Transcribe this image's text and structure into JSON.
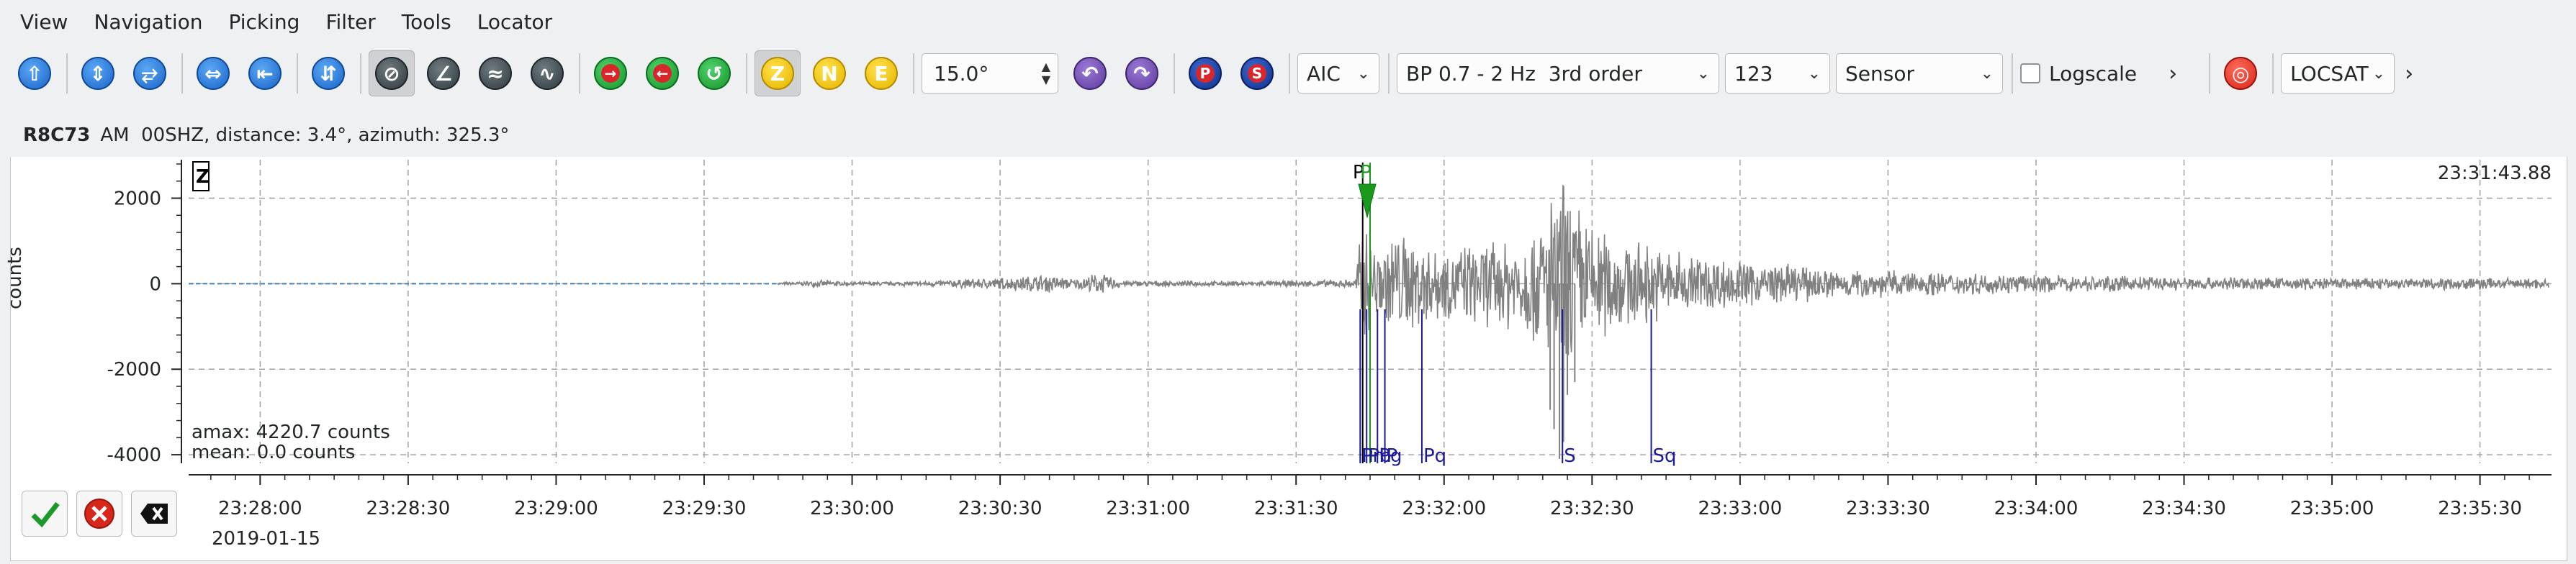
{
  "menubar": {
    "items": [
      "View",
      "Navigation",
      "Picking",
      "Filter",
      "Tools",
      "Locator"
    ]
  },
  "toolbar": {
    "z_label": "Z",
    "n_label": "N",
    "e_label": "E",
    "angle_value": "15.0°",
    "p_label": "P",
    "s_label": "S",
    "picker_value": "AIC",
    "filter_value": "BP 0.7 - 2 Hz  3rd order",
    "components_value": "123",
    "rotation_value": "Sensor",
    "logscale_label": "Logscale",
    "locator_value": "LOCSAT",
    "overflow_glyph": "›"
  },
  "trace": {
    "station": "R8C73",
    "info": "AM  00SHZ, distance: 3.4°, azimuth: 325.3°",
    "component_tag": "Z",
    "end_time": "23:31:43.88",
    "amax": "amax: 4220.7 counts",
    "mean": "mean: 0.0 counts",
    "ylabel": "counts",
    "date": "2019-01-15"
  },
  "chart_data": {
    "type": "line",
    "xlabel": "",
    "ylabel": "counts",
    "ylim": [
      -4200,
      2900
    ],
    "y_ticks": [
      "2000",
      "0",
      "-2000",
      "-4000"
    ],
    "y_tick_values": [
      2000,
      0,
      -2000,
      -4000
    ],
    "x_ticks": [
      "23:28:00",
      "23:28:30",
      "23:29:00",
      "23:29:30",
      "23:30:00",
      "23:30:30",
      "23:31:00",
      "23:31:30",
      "23:32:00",
      "23:32:30",
      "23:33:00",
      "23:33:30",
      "23:34:00",
      "23:34:30",
      "23:35:00",
      "23:35:30"
    ],
    "x_tick_seconds": [
      0,
      30,
      60,
      90,
      120,
      150,
      180,
      210,
      240,
      270,
      300,
      330,
      360,
      390,
      420,
      450
    ],
    "xlim_seconds": [
      -14.5,
      464.5
    ],
    "data_start_seconds": 105,
    "grid": true,
    "picks_top": [
      {
        "label": "P",
        "t": 223.5,
        "color": "#000000"
      },
      {
        "label": "P",
        "t": 225.0,
        "color": "#1a9a1a"
      }
    ],
    "picks_bottom": [
      {
        "label": "Pn",
        "t": 223.0
      },
      {
        "label": "Pb",
        "t": 224.3
      },
      {
        "label": "Pg",
        "t": 226.5
      },
      {
        "label": "P",
        "t": 228.0
      },
      {
        "label": "Pq",
        "t": 235.5
      },
      {
        "label": "S",
        "t": 264.0
      },
      {
        "label": "Sq",
        "t": 282.0
      }
    ],
    "envelope": [
      {
        "t": 105,
        "a": 30
      },
      {
        "t": 110,
        "a": 60
      },
      {
        "t": 115,
        "a": 90
      },
      {
        "t": 120,
        "a": 45
      },
      {
        "t": 135,
        "a": 70
      },
      {
        "t": 150,
        "a": 160
      },
      {
        "t": 160,
        "a": 240
      },
      {
        "t": 165,
        "a": 120
      },
      {
        "t": 170,
        "a": 280
      },
      {
        "t": 175,
        "a": 80
      },
      {
        "t": 200,
        "a": 60
      },
      {
        "t": 215,
        "a": 90
      },
      {
        "t": 222,
        "a": 120
      },
      {
        "t": 223.5,
        "a": 1900
      },
      {
        "t": 226,
        "a": 900
      },
      {
        "t": 230,
        "a": 1400
      },
      {
        "t": 240,
        "a": 900
      },
      {
        "t": 250,
        "a": 1100
      },
      {
        "t": 258,
        "a": 1400
      },
      {
        "t": 262,
        "a": 2300
      },
      {
        "t": 265,
        "a": 2800
      },
      {
        "t": 268,
        "a": 1800
      },
      {
        "t": 275,
        "a": 1200
      },
      {
        "t": 285,
        "a": 900
      },
      {
        "t": 300,
        "a": 600
      },
      {
        "t": 320,
        "a": 380
      },
      {
        "t": 340,
        "a": 300
      },
      {
        "t": 360,
        "a": 220
      },
      {
        "t": 390,
        "a": 180
      },
      {
        "t": 420,
        "a": 150
      },
      {
        "t": 450,
        "a": 160
      },
      {
        "t": 464,
        "a": 120
      }
    ],
    "deep_spikes": [
      {
        "t": 261.5,
        "v": -2950
      },
      {
        "t": 262.3,
        "v": -3400
      },
      {
        "t": 263.4,
        "v": -4100
      },
      {
        "t": 264.2,
        "v": -3700
      },
      {
        "t": 265.0,
        "v": -2600
      },
      {
        "t": 266.5,
        "v": -2300
      }
    ]
  }
}
